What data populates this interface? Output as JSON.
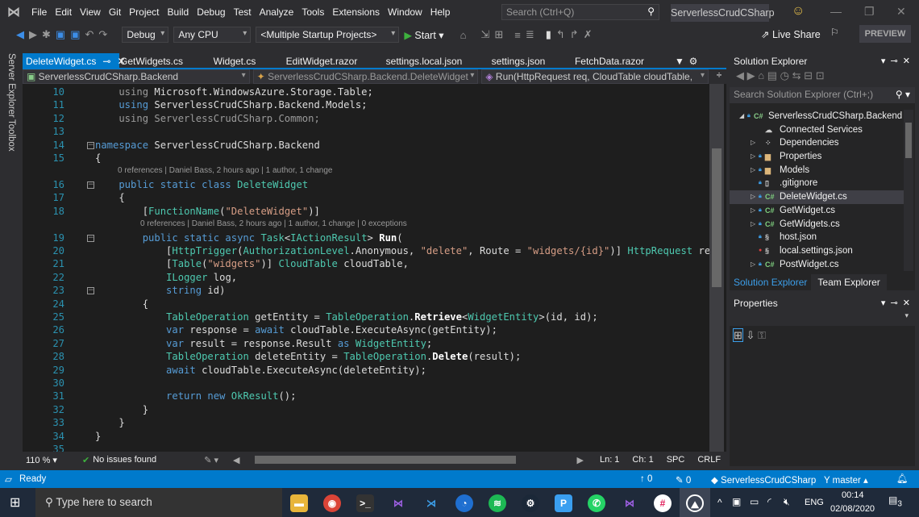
{
  "menubar": {
    "items": [
      "File",
      "Edit",
      "View",
      "Git",
      "Project",
      "Build",
      "Debug",
      "Test",
      "Analyze",
      "Tools",
      "Extensions",
      "Window",
      "Help"
    ],
    "search_placeholder": "Search (Ctrl+Q)",
    "solution_title": "ServerlessCrudCSharp"
  },
  "toolbar": {
    "config": "Debug",
    "platform": "Any CPU",
    "startup": "<Multiple Startup Projects>",
    "start": "Start",
    "live_share": "Live Share",
    "preview": "PREVIEW"
  },
  "left_bar": {
    "server_explorer": "Server Explorer",
    "toolbox": "Toolbox"
  },
  "tabs": [
    "DeleteWidget.cs",
    "GetWidgets.cs",
    "Widget.cs",
    "EditWidget.razor",
    "settings.local.json",
    "settings.json",
    "FetchData.razor"
  ],
  "navbar": {
    "project": "ServerlessCrudCSharp.Backend",
    "class": "ServerlessCrudCSharp.Backend.DeleteWidget",
    "member": "Run(HttpRequest req, CloudTable cloudTable, ILogger"
  },
  "code": {
    "lines": [
      {
        "n": "10",
        "t": [
          [
            "    using ",
            "gr"
          ],
          [
            "Microsoft.WindowsAzure.Storage.Table;",
            "pl"
          ]
        ]
      },
      {
        "n": "11",
        "t": [
          [
            "    using ",
            "kw"
          ],
          [
            "ServerlessCrudCSharp.Backend.Models;",
            "pl"
          ]
        ]
      },
      {
        "n": "12",
        "t": [
          [
            "    using ",
            "gr"
          ],
          [
            "ServerlessCrudCSharp.Common;",
            "gr"
          ]
        ]
      },
      {
        "n": "13",
        "t": []
      },
      {
        "n": "14",
        "t": [
          [
            "namespace ",
            "kw"
          ],
          [
            "ServerlessCrudCSharp.Backend",
            "pl"
          ]
        ]
      },
      {
        "n": "15",
        "t": [
          [
            "{",
            "pl"
          ]
        ]
      },
      {
        "n": "16",
        "t": [
          [
            "    public static class ",
            "kw"
          ],
          [
            "DeleteWidget",
            "ty"
          ]
        ]
      },
      {
        "n": "17",
        "t": [
          [
            "    {",
            "pl"
          ]
        ]
      },
      {
        "n": "18",
        "t": [
          [
            "        [",
            "pl"
          ],
          [
            "FunctionName",
            "ty"
          ],
          [
            "(",
            "pl"
          ],
          [
            "\"DeleteWidget\"",
            "st"
          ],
          [
            ")]",
            "pl"
          ]
        ]
      },
      {
        "n": "19",
        "t": [
          [
            "        public static async ",
            "kw"
          ],
          [
            "Task",
            "ty"
          ],
          [
            "<",
            "pl"
          ],
          [
            "IActionResult",
            "ty"
          ],
          [
            "> ",
            "pl"
          ],
          [
            "Run",
            "me"
          ],
          [
            "(",
            "pl"
          ]
        ]
      },
      {
        "n": "20",
        "t": [
          [
            "            [",
            "pl"
          ],
          [
            "HttpTrigger",
            "ty"
          ],
          [
            "(",
            "pl"
          ],
          [
            "AuthorizationLevel",
            "ty"
          ],
          [
            ".Anonymous, ",
            "pl"
          ],
          [
            "\"delete\"",
            "st"
          ],
          [
            ", Route = ",
            "pl"
          ],
          [
            "\"widgets/{id}\"",
            "st"
          ],
          [
            ")] ",
            "pl"
          ],
          [
            "HttpRequest",
            "ty"
          ],
          [
            " req,",
            "pl"
          ]
        ]
      },
      {
        "n": "21",
        "t": [
          [
            "            [",
            "pl"
          ],
          [
            "Table",
            "ty"
          ],
          [
            "(",
            "pl"
          ],
          [
            "\"widgets\"",
            "st"
          ],
          [
            ")] ",
            "pl"
          ],
          [
            "CloudTable",
            "ty"
          ],
          [
            " cloudTable,",
            "pl"
          ]
        ]
      },
      {
        "n": "22",
        "t": [
          [
            "            ",
            "pl"
          ],
          [
            "ILogger",
            "ty"
          ],
          [
            " log,",
            "pl"
          ]
        ]
      },
      {
        "n": "23",
        "t": [
          [
            "            string ",
            "kw"
          ],
          [
            "id)",
            "pl"
          ]
        ]
      },
      {
        "n": "24",
        "t": [
          [
            "        {",
            "pl"
          ]
        ]
      },
      {
        "n": "25",
        "t": [
          [
            "            ",
            "pl"
          ],
          [
            "TableOperation",
            "ty"
          ],
          [
            " getEntity = ",
            "pl"
          ],
          [
            "TableOperation",
            "ty"
          ],
          [
            ".",
            "pl"
          ],
          [
            "Retrieve",
            "me"
          ],
          [
            "<",
            "pl"
          ],
          [
            "WidgetEntity",
            "ty"
          ],
          [
            ">(id, id);",
            "pl"
          ]
        ]
      },
      {
        "n": "26",
        "t": [
          [
            "            var ",
            "kw"
          ],
          [
            "response = ",
            "pl"
          ],
          [
            "await ",
            "kw"
          ],
          [
            "cloudTable.ExecuteAsync(getEntity);",
            "pl"
          ]
        ]
      },
      {
        "n": "27",
        "t": [
          [
            "            var ",
            "kw"
          ],
          [
            "result = response.Result ",
            "pl"
          ],
          [
            "as ",
            "kw"
          ],
          [
            "WidgetEntity",
            "ty"
          ],
          [
            ";",
            "pl"
          ]
        ]
      },
      {
        "n": "28",
        "t": [
          [
            "            ",
            "pl"
          ],
          [
            "TableOperation",
            "ty"
          ],
          [
            " deleteEntity = ",
            "pl"
          ],
          [
            "TableOperation",
            "ty"
          ],
          [
            ".",
            "pl"
          ],
          [
            "Delete",
            "me"
          ],
          [
            "(result);",
            "pl"
          ]
        ]
      },
      {
        "n": "29",
        "t": [
          [
            "            await ",
            "kw"
          ],
          [
            "cloudTable.ExecuteAsync(deleteEntity);",
            "pl"
          ]
        ]
      },
      {
        "n": "30",
        "t": []
      },
      {
        "n": "31",
        "t": [
          [
            "            return new ",
            "kw"
          ],
          [
            "OkResult",
            "ty"
          ],
          [
            "();",
            "pl"
          ]
        ]
      },
      {
        "n": "32",
        "t": [
          [
            "        }",
            "pl"
          ]
        ]
      },
      {
        "n": "33",
        "t": [
          [
            "    }",
            "pl"
          ]
        ]
      },
      {
        "n": "34",
        "t": [
          [
            "}",
            "pl"
          ]
        ]
      },
      {
        "n": "35",
        "t": []
      }
    ],
    "codelens_class": "0 references | Daniel Bass, 2 hours ago | 1 author, 1 change",
    "codelens_method": "0 references | Daniel Bass, 2 hours ago | 1 author, 1 change | 0 exceptions"
  },
  "editor_status": {
    "zoom": "110 %",
    "issues": "No issues found",
    "ln": "Ln: 1",
    "ch": "Ch: 1",
    "spc": "SPC",
    "crlf": "CRLF"
  },
  "solution_explorer": {
    "title": "Solution Explorer",
    "search_placeholder": "Search Solution Explorer (Ctrl+;)",
    "items": [
      {
        "label": "ServerlessCrudCSharp.Backend",
        "icon": "csharp-project-icon",
        "level": 0,
        "expander": "expanded"
      },
      {
        "label": "Connected Services",
        "icon": "cloud-icon",
        "level": 1,
        "expander": "none"
      },
      {
        "label": "Dependencies",
        "icon": "dependencies-icon",
        "level": 1,
        "expander": "collapsed"
      },
      {
        "label": "Properties",
        "icon": "folder-icon",
        "level": 1,
        "expander": "collapsed"
      },
      {
        "label": "Models",
        "icon": "folder-icon",
        "level": 1,
        "expander": "collapsed"
      },
      {
        "label": ".gitignore",
        "icon": "file-icon",
        "level": 1,
        "expander": "none"
      },
      {
        "label": "DeleteWidget.cs",
        "icon": "csharp-file-icon",
        "level": 1,
        "expander": "collapsed",
        "selected": true
      },
      {
        "label": "GetWidget.cs",
        "icon": "csharp-file-icon",
        "level": 1,
        "expander": "collapsed"
      },
      {
        "label": "GetWidgets.cs",
        "icon": "csharp-file-icon",
        "level": 1,
        "expander": "collapsed"
      },
      {
        "label": "host.json",
        "icon": "json-file-icon",
        "level": 1,
        "expander": "none"
      },
      {
        "label": "local.settings.json",
        "icon": "json-file-icon",
        "level": 1,
        "expander": "none"
      },
      {
        "label": "PostWidget.cs",
        "icon": "csharp-file-icon",
        "level": 1,
        "expander": "collapsed"
      }
    ],
    "tabs": [
      "Solution Explorer",
      "Team Explorer"
    ]
  },
  "properties": {
    "title": "Properties"
  },
  "statusbar": {
    "ready": "Ready",
    "up_count": "0",
    "pencil_count": "0",
    "repo": "ServerlessCrudCSharp",
    "branch": "master"
  },
  "taskbar": {
    "search_placeholder": "Type here to search",
    "time": "00:14",
    "date": "02/08/2020",
    "lang": "ENG",
    "notifications": "3"
  },
  "colors": {
    "accent": "#007acc",
    "keyword": "#569cd6",
    "type": "#4ec9b0",
    "string": "#d69d85"
  }
}
